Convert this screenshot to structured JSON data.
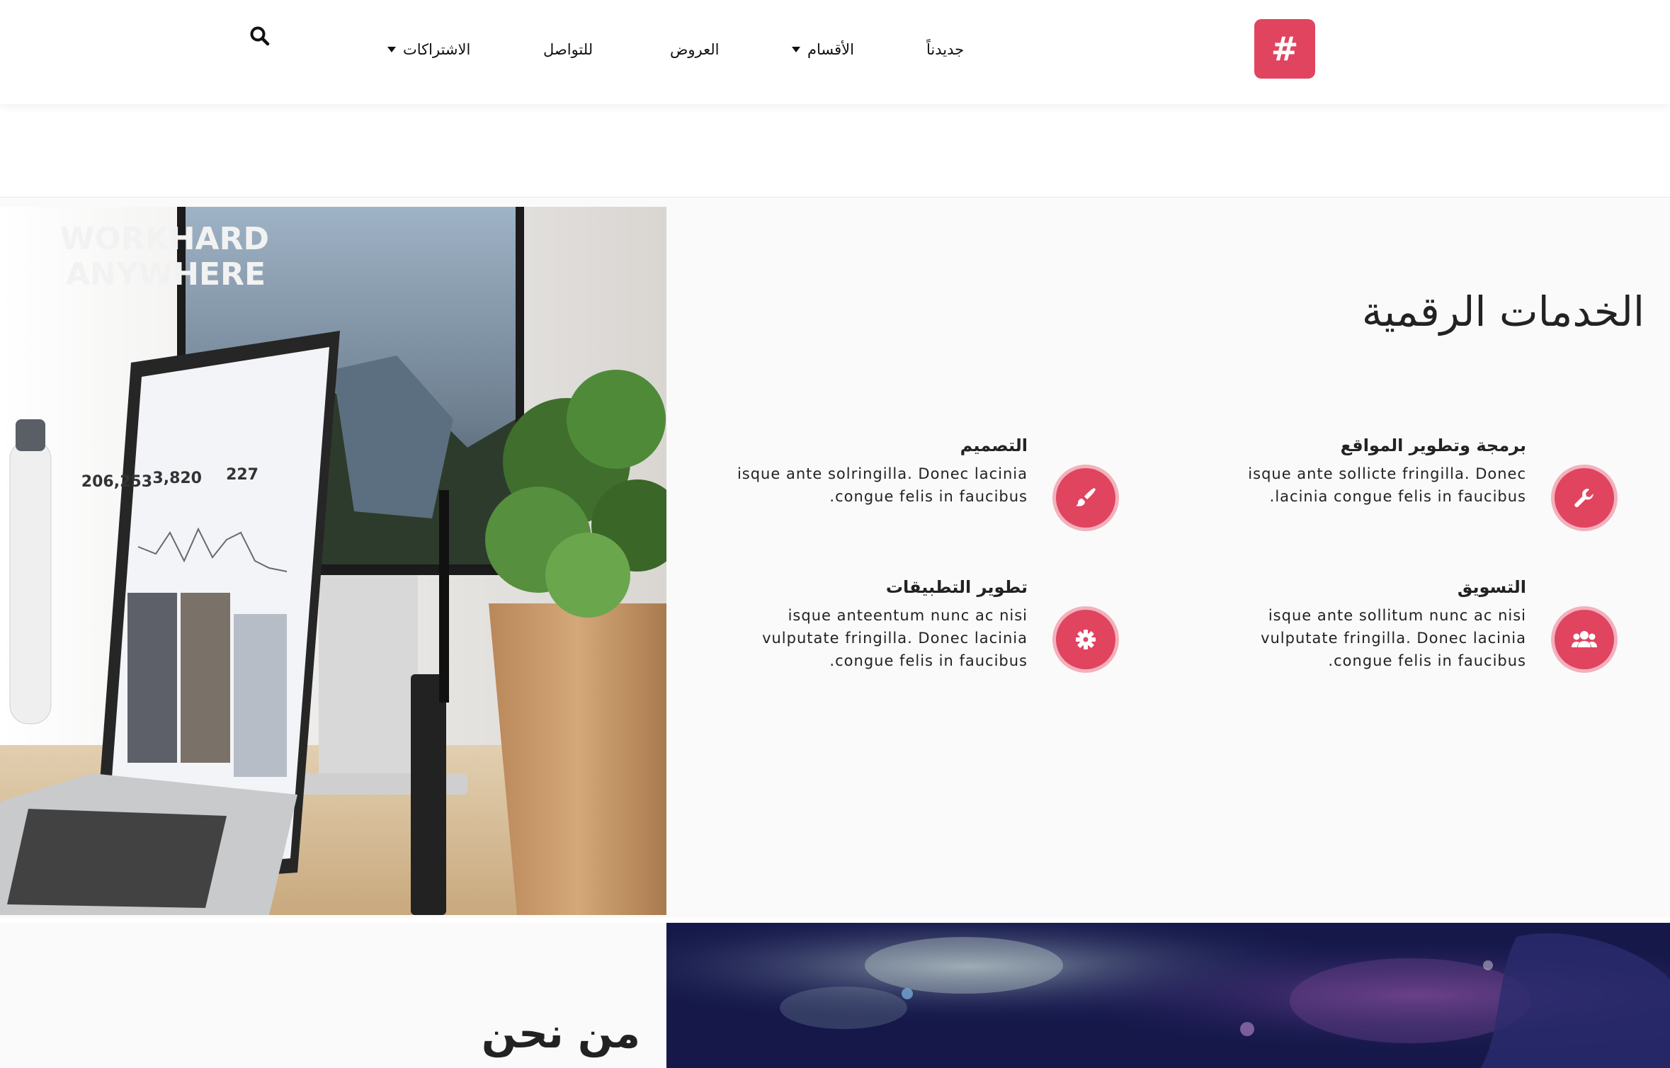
{
  "colors": {
    "accent": "#e0445f",
    "accent_light": "#f2b1bc",
    "text": "#222222",
    "section_bg": "#fafafa"
  },
  "brand": {
    "symbol": "#"
  },
  "nav": {
    "items": [
      {
        "label": "جديدناً",
        "has_dropdown": false
      },
      {
        "label": "الأقسام",
        "has_dropdown": true
      },
      {
        "label": "العروض",
        "has_dropdown": false
      },
      {
        "label": "للتواصل",
        "has_dropdown": false
      },
      {
        "label": "الاشتراكات",
        "has_dropdown": true
      }
    ],
    "search_icon": "search-icon"
  },
  "services": {
    "title": "الخدمات الرقمية",
    "items": [
      {
        "heading": "برمجة وتطوير المواقع",
        "text": "isque ante sollicte fringilla. Donec lacinia congue felis in faucibus.",
        "icon": "wrench-icon"
      },
      {
        "heading": "التصميم",
        "text": "isque ante solringilla. Donec lacinia congue felis in faucibus.",
        "icon": "brush-icon"
      },
      {
        "heading": "التسويق",
        "text": "isque ante sollitum nunc ac nisi vulputate fringilla. Donec lacinia congue felis in faucibus.",
        "icon": "users-icon"
      },
      {
        "heading": "تطوير التطبيقات",
        "text": "isque anteentum nunc ac nisi vulputate fringilla. Donec lacinia congue felis in faucibus.",
        "icon": "gear-icon"
      }
    ],
    "image": {
      "screen_line1": "WORKHARD",
      "screen_line2": "ANYWHERE",
      "stat1": "206,253",
      "stat2": "3,820",
      "stat3": "227"
    }
  },
  "about": {
    "title": "من نحن"
  }
}
